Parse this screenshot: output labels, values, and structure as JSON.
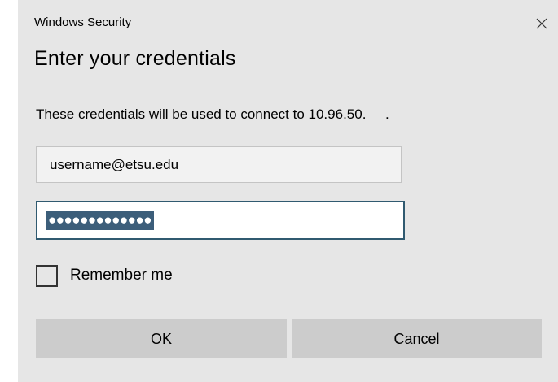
{
  "window": {
    "title": "Windows Security",
    "close_icon": "close-icon"
  },
  "dialog": {
    "heading": "Enter your credentials",
    "description": "These credentials will be used to connect to 10.96.50.     ."
  },
  "username": {
    "value": "username@etsu.edu"
  },
  "password": {
    "masked_value": "●●●●●●●●●●●●●",
    "selected": true
  },
  "remember": {
    "label": "Remember me",
    "checked": false
  },
  "buttons": {
    "ok_label": "OK",
    "cancel_label": "Cancel"
  },
  "colors": {
    "dialog_bg": "#e6e6e6",
    "button_bg": "#cccccc",
    "focus_border": "#305a70",
    "selection_bg": "#3c5e7a"
  }
}
